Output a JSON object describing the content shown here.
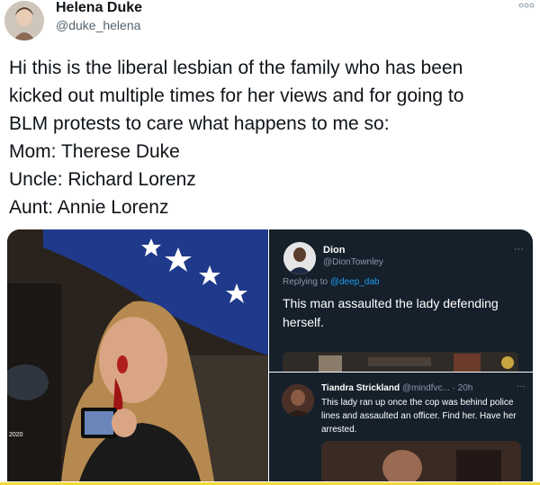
{
  "author": {
    "display_name": "Helena Duke",
    "handle": "@duke_helena"
  },
  "tweet": {
    "lines": [
      "Hi this is the liberal lesbian of the family who has been",
      "kicked out multiple times for her views and for going to",
      "BLM protests to care what happens to me so:",
      "Mom: Therese Duke",
      "Uncle: Richard Lorenz",
      "Aunt: Annie Lorenz"
    ]
  },
  "photo": {
    "badge": "2020"
  },
  "embedded_tweet_1": {
    "name": "Dion",
    "handle": "@DionTownley",
    "replying_prefix": "Replying to ",
    "replying_mention": "@deep_dab",
    "text": "This man assaulted the lady defending herself.",
    "more": "···"
  },
  "embedded_tweet_2": {
    "name": "Tiandra Strickland",
    "handle": "@mindfvc... · 20h",
    "text": "This lady ran up once the cop was behind police lines and assaulted an officer. Find her. Have her arrested.",
    "more": "···"
  },
  "icons": {
    "more": "more-options-icon"
  }
}
